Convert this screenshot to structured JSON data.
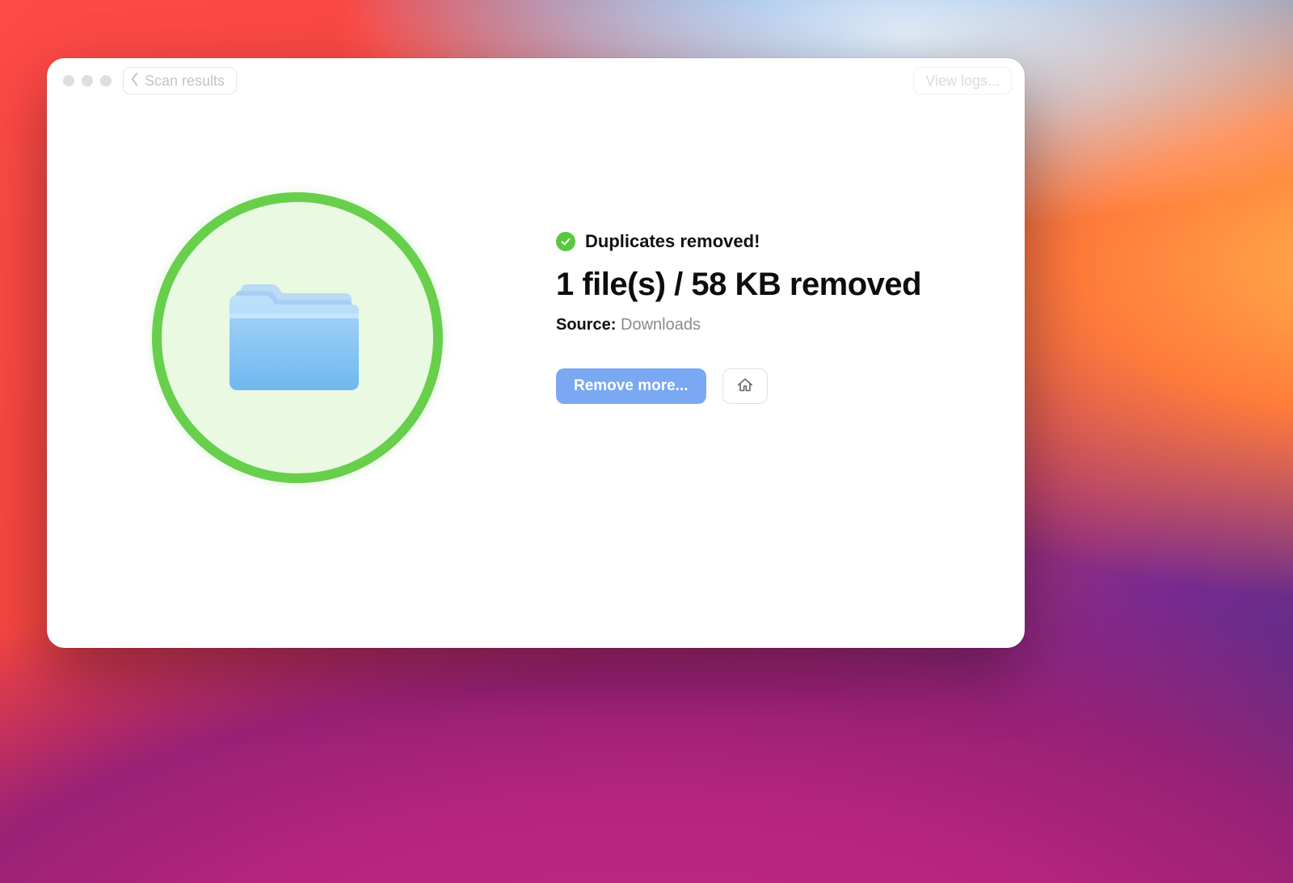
{
  "titlebar": {
    "back_label": "Scan results",
    "view_logs_label": "View logs..."
  },
  "result": {
    "status_text": "Duplicates removed!",
    "headline": "1 file(s) / 58 KB removed",
    "source_label": "Source:",
    "source_value": "Downloads",
    "remove_more_label": "Remove more..."
  },
  "colors": {
    "success_ring": "#67CF4B",
    "success_fill": "#e9f9e2",
    "primary_button": "#7aa8f2",
    "check_badge": "#58c93e"
  }
}
